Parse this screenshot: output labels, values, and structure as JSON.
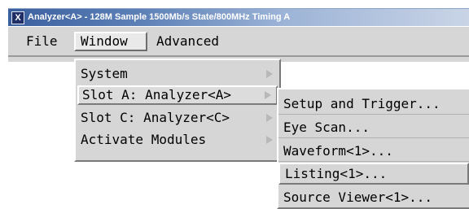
{
  "titlebar": {
    "icon_letter": "X",
    "title": "Analyzer<A> - 128M Sample 1500Mb/s State/800MHz Timing A"
  },
  "menubar": {
    "items": [
      {
        "label": "File"
      },
      {
        "label": "Window"
      },
      {
        "label": "Advanced"
      }
    ]
  },
  "window_menu": {
    "items": [
      {
        "label": "System"
      },
      {
        "label": "Slot A: Analyzer<A>"
      },
      {
        "label": "Slot C: Analyzer<C>"
      },
      {
        "label": "Activate Modules"
      }
    ]
  },
  "slot_a_submenu": {
    "items": [
      {
        "label": "Setup and Trigger..."
      },
      {
        "label": "Eye Scan..."
      },
      {
        "label": "Waveform<1>..."
      },
      {
        "label": "Listing<1>..."
      },
      {
        "label": "Source Viewer<1>..."
      }
    ]
  },
  "colors": {
    "titlebar_start": "#3a5f9e",
    "menu_background": "#d6d6d6",
    "submenu_arrow": "#b8b8b8"
  }
}
